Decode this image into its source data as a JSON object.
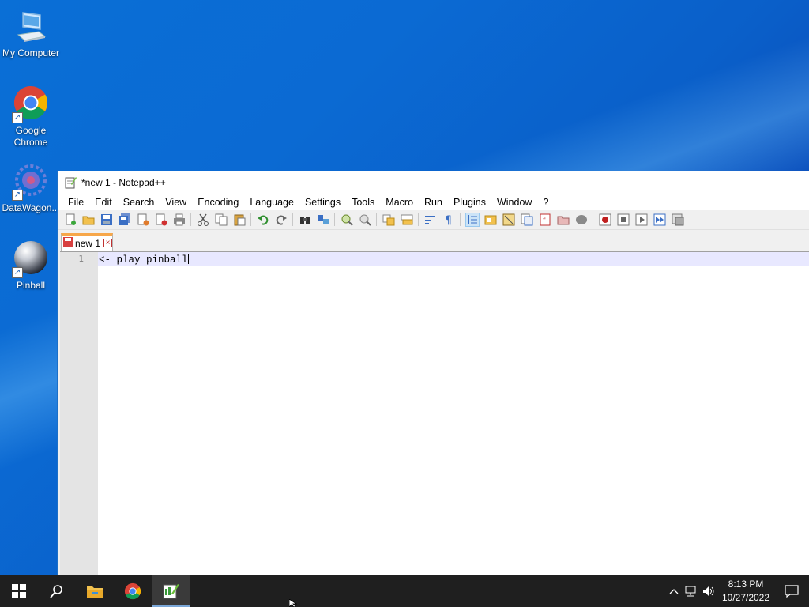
{
  "desktop": {
    "icons": [
      {
        "label": "My Computer",
        "icon": "computer-icon"
      },
      {
        "label": "Google Chrome",
        "icon": "chrome-icon"
      },
      {
        "label": "DataWagon...",
        "icon": "datawagon-icon"
      },
      {
        "label": "Pinball",
        "icon": "pinball-icon"
      }
    ]
  },
  "window": {
    "title": "*new 1 - Notepad++",
    "minimize_glyph": "—",
    "menu": [
      "File",
      "Edit",
      "Search",
      "View",
      "Encoding",
      "Language",
      "Settings",
      "Tools",
      "Macro",
      "Run",
      "Plugins",
      "Window",
      "?"
    ],
    "tab": {
      "label": "new 1",
      "close_glyph": "×"
    },
    "editor": {
      "line_number": "1",
      "content": "<- play pinball"
    }
  },
  "taskbar": {
    "time": "8:13 PM",
    "date": "10/27/2022",
    "items": [
      "start-button",
      "search-button",
      "file-explorer",
      "google-chrome",
      "notepad-plus-plus"
    ]
  },
  "colors": {
    "accent": "#0b6ad3",
    "taskbar": "#1f1f1f",
    "tab_accent": "#f7a74a"
  }
}
